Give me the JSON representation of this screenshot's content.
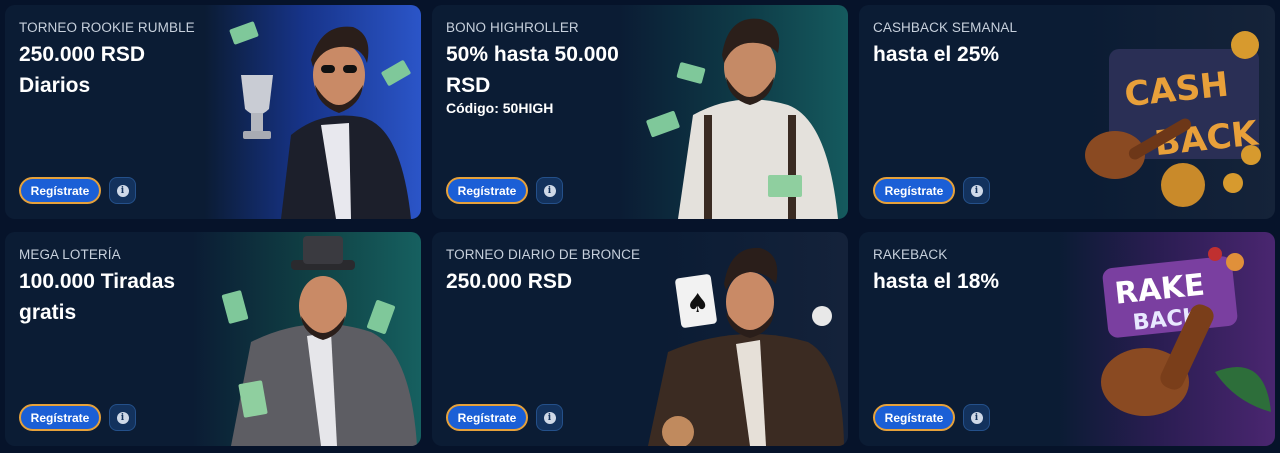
{
  "cards": [
    {
      "tag": "TORNEO ROOKIE RUMBLE",
      "headline": "250.000 RSD Diarios",
      "code": "",
      "button": "Regístrate",
      "info_icon": "info-icon",
      "accent": "#1d4fb0"
    },
    {
      "tag": "BONO HIGHROLLER",
      "headline": "50% hasta 50.000 RSD",
      "code": "Código: 50HIGH",
      "button": "Regístrate",
      "info_icon": "info-icon",
      "accent": "#0f4a4f"
    },
    {
      "tag": "CASHBACK SEMANAL",
      "headline": "hasta el 25%",
      "code": "",
      "button": "Regístrate",
      "info_icon": "info-icon",
      "accent": "#17243d"
    },
    {
      "tag": "MEGA LOTERÍA",
      "headline": "100.000 Tiradas gratis",
      "code": "",
      "button": "Regístrate",
      "info_icon": "info-icon",
      "accent": "#125055"
    },
    {
      "tag": "TORNEO DIARIO DE BRONCE",
      "headline": "250.000 RSD",
      "code": "",
      "button": "Regístrate",
      "info_icon": "info-icon",
      "accent": "#16243c"
    },
    {
      "tag": "RAKEBACK",
      "headline": "hasta el 18%",
      "code": "",
      "button": "Regístrate",
      "info_icon": "info-icon",
      "accent": "#3a1e5e"
    }
  ],
  "artwork": {
    "cashback_text": "CASH BACK",
    "rakeback_text": "RAKE BACK"
  },
  "colors": {
    "page_bg": "#06132a",
    "card_bg": "#0b1c34",
    "button_bg": "#1b5fd6",
    "button_border": "#e6a13a"
  }
}
